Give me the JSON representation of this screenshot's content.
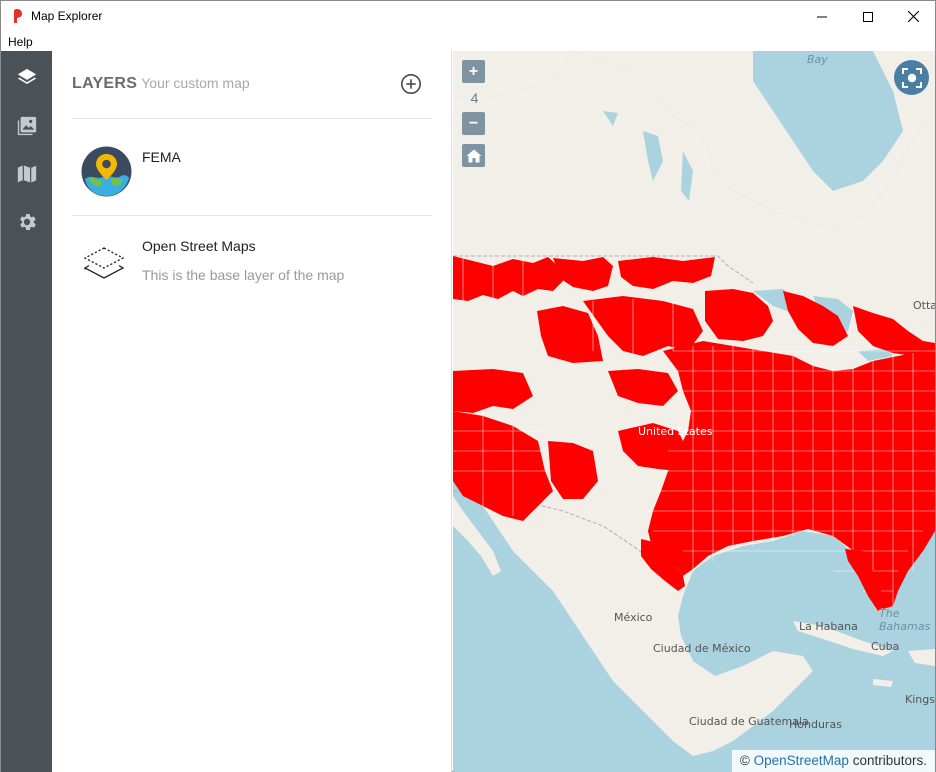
{
  "window": {
    "title": "Map Explorer",
    "menu": [
      "Help"
    ],
    "minimize_glyph": "—",
    "maximize_glyph": "☐",
    "close_glyph": "✕"
  },
  "rail": {
    "items": [
      {
        "icon": "layers-icon",
        "active": true
      },
      {
        "icon": "image-gallery-icon",
        "active": false
      },
      {
        "icon": "map-icon",
        "active": false
      },
      {
        "icon": "gear-icon",
        "active": false
      }
    ]
  },
  "layers_panel": {
    "title": "LAYERS",
    "subtitle": "Your custom map",
    "layers": [
      {
        "name": "FEMA",
        "description": "",
        "icon": "map-pin-globe-icon"
      },
      {
        "name": "Open Street Maps",
        "description": "This is the base layer of the map",
        "icon": "stacked-layers-icon"
      }
    ]
  },
  "map": {
    "zoom_in": "+",
    "zoom_level": "4",
    "zoom_out": "−",
    "labels": {
      "bay": "Bay",
      "united_states": "United States",
      "mexico": "México",
      "ciudad_de_mexico": "Ciudad de México",
      "la_habana": "La Habana",
      "cuba": "Cuba",
      "the_bahamas": "The Bahamas",
      "ciudad_de_guatemala": "Ciudad de Guatemala",
      "honduras": "Honduras",
      "kingston": "Kingston",
      "ottawa": "Otta"
    },
    "attribution_prefix": "©",
    "attribution_link": "OpenStreetMap",
    "attribution_suffix": "contributors.",
    "colors": {
      "water": "#aad3df",
      "land": "#f2efe9",
      "fema_fill": "#ff0000"
    }
  }
}
